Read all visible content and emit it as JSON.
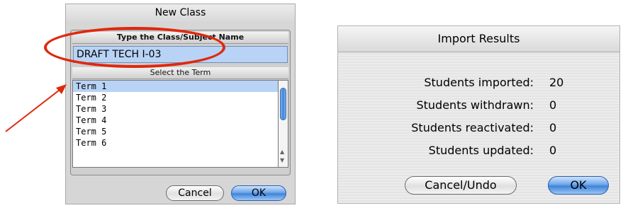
{
  "new_class": {
    "title": "New Class",
    "name_header": "Type the Class/Subject Name",
    "name_value": "DRAFT TECH I-03",
    "term_header": "Select the Term",
    "terms": [
      "Term 1",
      "Term 2",
      "Term 3",
      "Term 4",
      "Term 5",
      "Term 6"
    ],
    "selected_term": "Term 1",
    "cancel_label": "Cancel",
    "ok_label": "OK"
  },
  "import_results": {
    "title": "Import Results",
    "rows": [
      {
        "label": "Students imported:",
        "value": "20"
      },
      {
        "label": "Students withdrawn:",
        "value": "0"
      },
      {
        "label": "Students reactivated:",
        "value": "0"
      },
      {
        "label": "Students updated:",
        "value": "0"
      }
    ],
    "cancel_label": "Cancel/Undo",
    "ok_label": "OK"
  },
  "colors": {
    "selection": "#b8d3f5",
    "annotation": "#e0280e",
    "default_button": "#3f84da"
  }
}
